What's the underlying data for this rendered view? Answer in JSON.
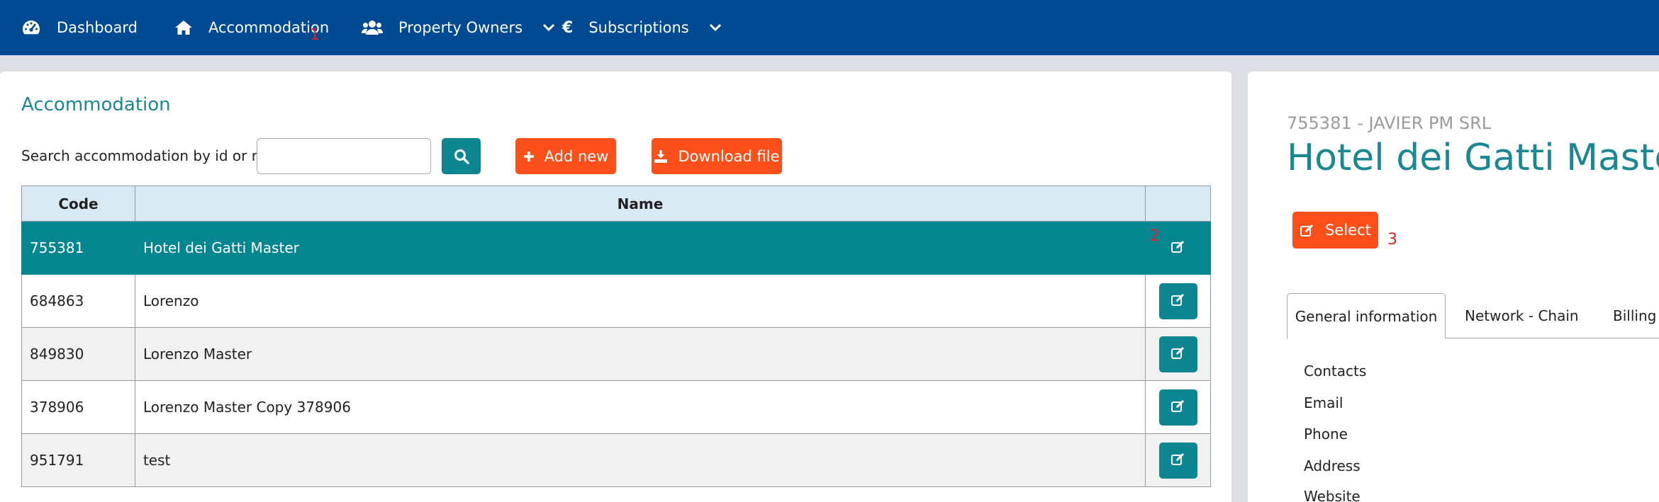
{
  "nav": {
    "dashboard": "Dashboard",
    "accommodation": "Accommodation",
    "property_owners": "Property Owners",
    "subscriptions": "Subscriptions"
  },
  "markers": {
    "m1": "1",
    "m2": "2",
    "m3": "3"
  },
  "main": {
    "title": "Accommodation",
    "search_label": "Search accommodation by id or name:",
    "search_value": "",
    "add_new": "Add new",
    "download": "Download file",
    "columns": {
      "code": "Code",
      "name": "Name"
    },
    "rows": [
      {
        "code": "755381",
        "name": "Hotel dei Gatti Master"
      },
      {
        "code": "684863",
        "name": "Lorenzo"
      },
      {
        "code": "849830",
        "name": "Lorenzo Master"
      },
      {
        "code": "378906",
        "name": "Lorenzo Master Copy 378906"
      },
      {
        "code": "951791",
        "name": "test"
      }
    ]
  },
  "detail": {
    "subtitle": "755381 - JAVIER PM SRL",
    "title": "Hotel dei Gatti Master",
    "select_label": "Select",
    "tabs": [
      "General information",
      "Network - Chain",
      "Billing"
    ],
    "info": [
      "Contacts",
      "Email",
      "Phone",
      "Address",
      "Website"
    ]
  },
  "colors": {
    "nav_bg": "#004a94",
    "accent": "#0e8691",
    "orange": "#fc4f1a",
    "title_teal": "#1a8793",
    "marker_red": "#e0202a"
  },
  "icons": {
    "dashboard": "gauge-icon",
    "accommodation": "home-icon",
    "property_owners": "users-icon",
    "subscriptions": "euro-icon",
    "search": "search-icon",
    "add": "plus-icon",
    "download": "download-icon",
    "edit": "edit-icon"
  }
}
